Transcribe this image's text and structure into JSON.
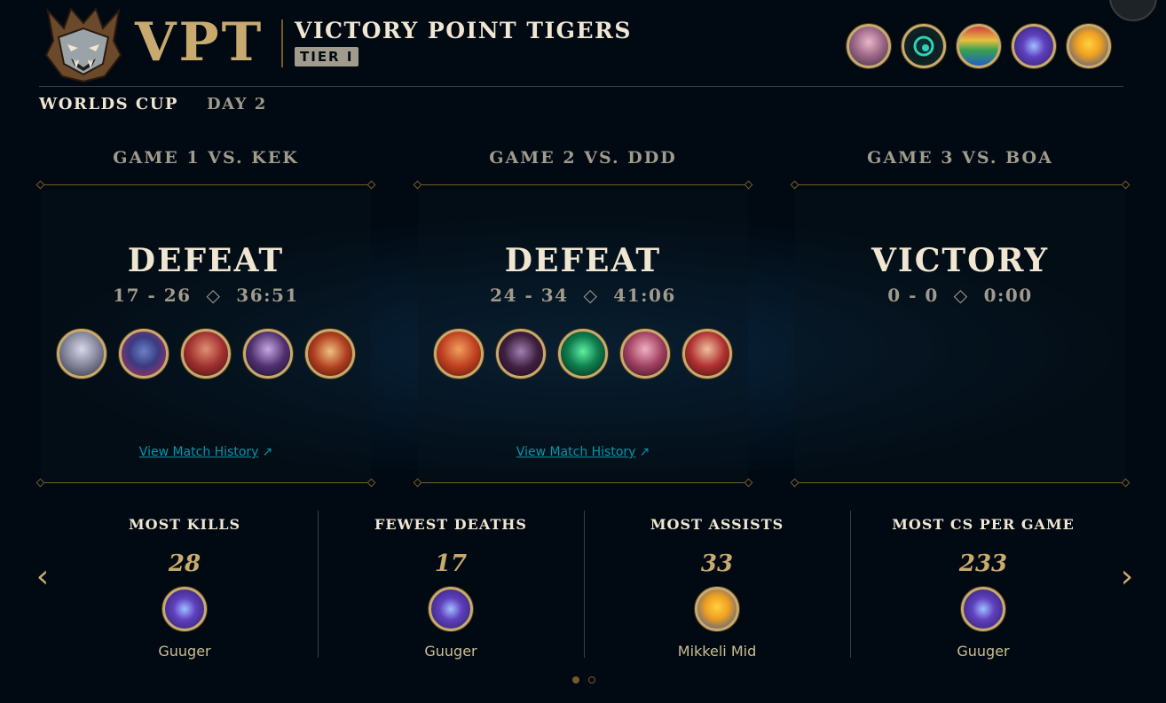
{
  "header": {
    "team_abbr": "VPT",
    "team_name": "VICTORY POINT TIGERS",
    "tier": "TIER I",
    "roster_icons": [
      "player-icon-portrait",
      "player-icon-orb",
      "player-icon-map",
      "player-icon-crystal",
      "player-icon-duck"
    ]
  },
  "tabs": [
    {
      "label": "WORLDS CUP",
      "active": true
    },
    {
      "label": "DAY 2",
      "active": false
    }
  ],
  "games": [
    {
      "title": "GAME 1 VS. KEK",
      "result": "DEFEAT",
      "score": "17 - 26",
      "duration": "36:51",
      "champion_icons": [
        "champion-icon",
        "champion-icon",
        "champion-icon",
        "champion-icon",
        "champion-icon"
      ],
      "history_link": "View Match History"
    },
    {
      "title": "GAME 2 VS. DDD",
      "result": "DEFEAT",
      "score": "24 - 34",
      "duration": "41:06",
      "champion_icons": [
        "champion-icon",
        "champion-icon",
        "champion-icon",
        "champion-icon",
        "champion-icon"
      ],
      "history_link": "View Match History"
    },
    {
      "title": "GAME 3 VS. BOA",
      "result": "VICTORY",
      "score": "0 - 0",
      "duration": "0:00",
      "champion_icons": [],
      "history_link": ""
    }
  ],
  "stats": [
    {
      "title": "MOST KILLS",
      "value": "28",
      "player": "Guuger",
      "icon": "crystal-icon"
    },
    {
      "title": "FEWEST DEATHS",
      "value": "17",
      "player": "Guuger",
      "icon": "crystal-icon"
    },
    {
      "title": "MOST ASSISTS",
      "value": "33",
      "player": "Mikkeli Mid",
      "icon": "duck-icon"
    },
    {
      "title": "MOST CS PER GAME",
      "value": "233",
      "player": "Guuger",
      "icon": "crystal-icon"
    }
  ],
  "pager": {
    "pages": 2,
    "active": 0
  },
  "colors": {
    "gold": "#c8aa6e",
    "gold_dark": "#785a28",
    "text_light": "#f0e6d2",
    "text_muted": "#a09b8c",
    "link": "#0397ab",
    "background": "#010a13"
  }
}
